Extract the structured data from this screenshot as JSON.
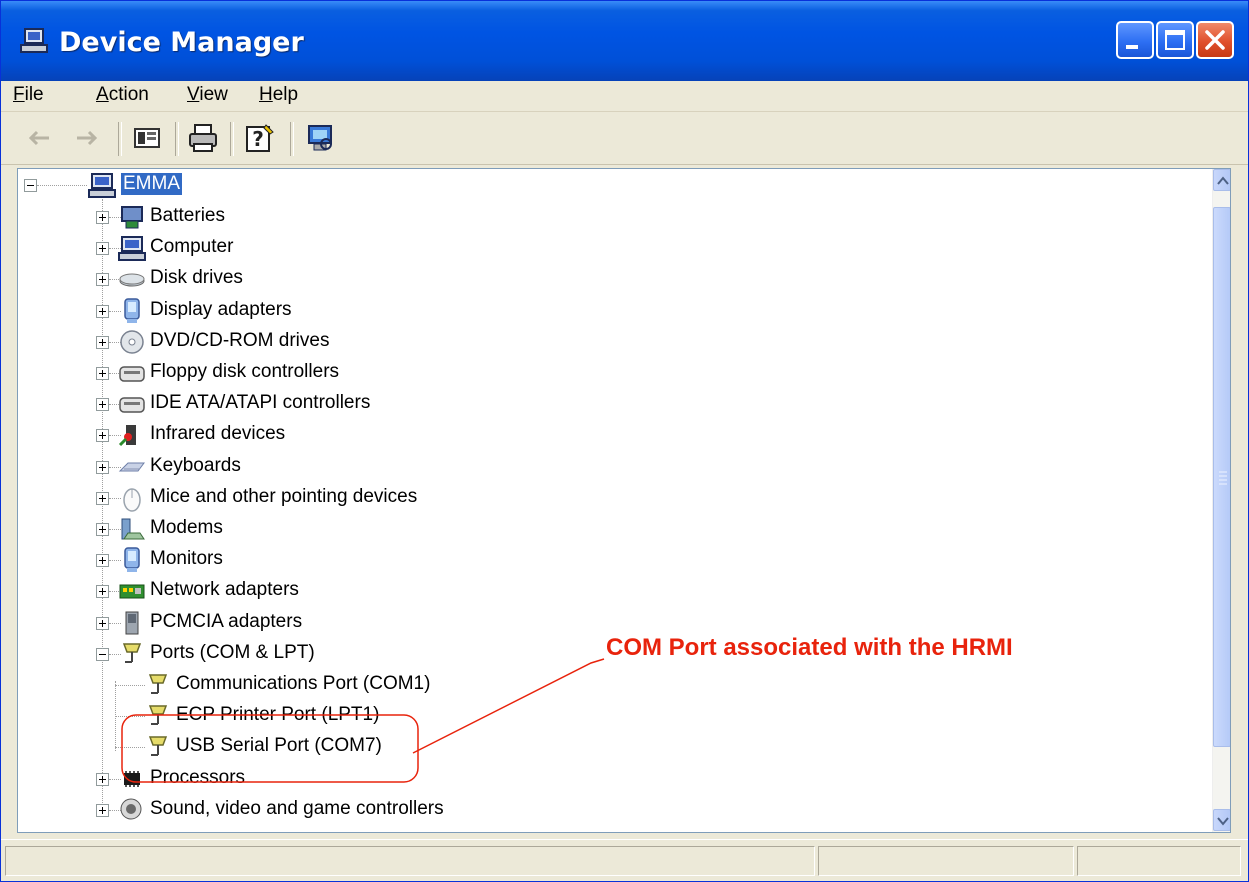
{
  "window": {
    "title": "Device Manager",
    "title_icon": "device-manager-icon",
    "controls": [
      "minimize-icon",
      "maximize-icon",
      "close-icon"
    ]
  },
  "menu": {
    "items": [
      {
        "mnemonic": "F",
        "rest": "ile"
      },
      {
        "mnemonic": "A",
        "rest": "ction"
      },
      {
        "mnemonic": "V",
        "rest": "iew"
      },
      {
        "mnemonic": "H",
        "rest": "elp"
      }
    ]
  },
  "toolbar": {
    "buttons": [
      "back-arrow-icon",
      "forward-arrow-icon",
      "show-hide-console-tree-icon",
      "print-icon",
      "help-icon",
      "scan-hardware-icon"
    ]
  },
  "tree": {
    "root": {
      "label": "EMMA",
      "icon": "computer-icon",
      "selected": true
    },
    "categories": [
      {
        "label": "Batteries",
        "icon": "battery-icon"
      },
      {
        "label": "Computer",
        "icon": "computer-icon"
      },
      {
        "label": "Disk drives",
        "icon": "disk-drive-icon"
      },
      {
        "label": "Display adapters",
        "icon": "display-adapter-icon"
      },
      {
        "label": "DVD/CD-ROM drives",
        "icon": "dvd-drive-icon"
      },
      {
        "label": "Floppy disk controllers",
        "icon": "controller-icon"
      },
      {
        "label": "IDE ATA/ATAPI controllers",
        "icon": "controller-icon"
      },
      {
        "label": "Infrared devices",
        "icon": "infrared-icon"
      },
      {
        "label": "Keyboards",
        "icon": "keyboard-icon"
      },
      {
        "label": "Mice and other pointing devices",
        "icon": "mouse-icon"
      },
      {
        "label": "Modems",
        "icon": "modem-icon"
      },
      {
        "label": "Monitors",
        "icon": "monitor-icon"
      },
      {
        "label": "Network adapters",
        "icon": "network-adapter-icon"
      },
      {
        "label": "PCMCIA adapters",
        "icon": "pcmcia-icon"
      },
      {
        "label": "Ports (COM & LPT)",
        "icon": "port-icon",
        "expanded": true,
        "children": [
          {
            "label": "Communications Port (COM1)",
            "icon": "port-icon"
          },
          {
            "label": "ECP Printer Port (LPT1)",
            "icon": "port-icon"
          },
          {
            "label": "USB Serial Port (COM7)",
            "icon": "port-icon"
          }
        ]
      },
      {
        "label": "Processors",
        "icon": "processor-icon"
      },
      {
        "label": "Sound, video and game controllers",
        "icon": "sound-icon"
      }
    ]
  },
  "annotation": {
    "text": "COM Port associated with the HRMI",
    "color": "#e8230c"
  },
  "colors": {
    "titlebar": "#0054e3",
    "selection": "#316ac5",
    "chrome": "#ece9d8"
  }
}
